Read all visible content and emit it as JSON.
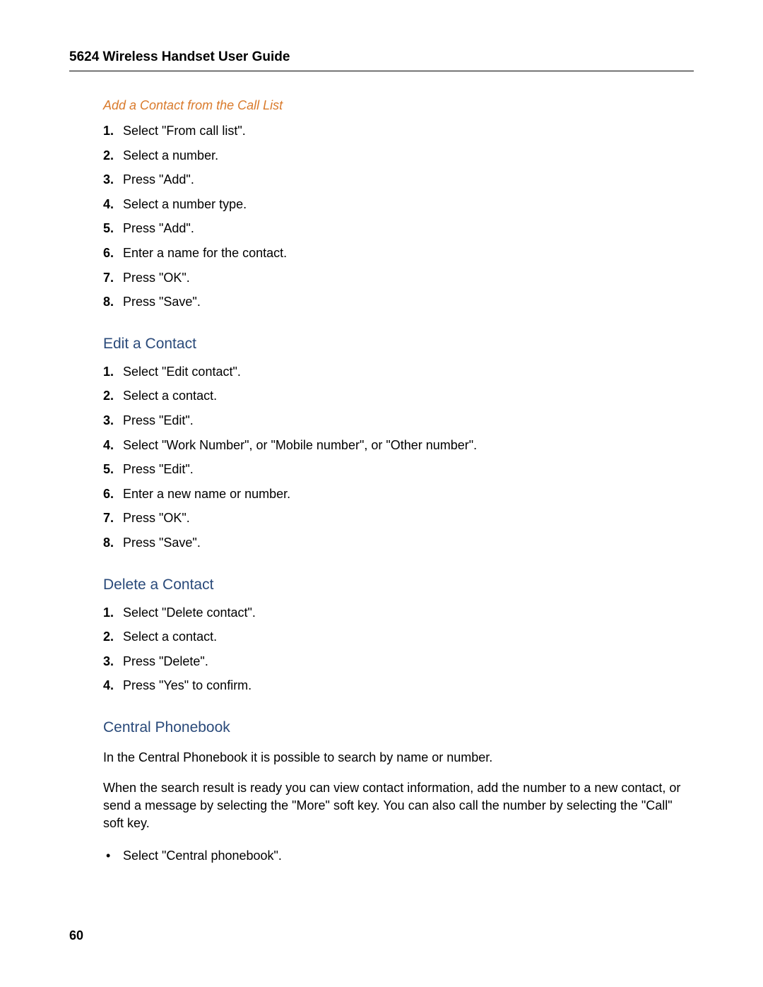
{
  "header": {
    "title": "5624 Wireless Handset User Guide"
  },
  "sections": {
    "addContact": {
      "title": "Add a Contact from the Call List",
      "steps": [
        "Select \"From call list\".",
        "Select a number.",
        "Press \"Add\".",
        "Select a number type.",
        "Press \"Add\".",
        "Enter a name for the contact.",
        "Press \"OK\".",
        "Press \"Save\"."
      ]
    },
    "editContact": {
      "title": "Edit a Contact",
      "steps": [
        "Select \"Edit contact\".",
        "Select a contact.",
        "Press \"Edit\".",
        "Select \"Work Number\", or \"Mobile number\", or \"Other number\".",
        "Press \"Edit\".",
        "Enter a new name or number.",
        "Press \"OK\".",
        "Press \"Save\"."
      ]
    },
    "deleteContact": {
      "title": "Delete a Contact",
      "steps": [
        "Select \"Delete contact\".",
        "Select a contact.",
        "Press \"Delete\".",
        "Press \"Yes\" to confirm."
      ]
    },
    "centralPhonebook": {
      "title": "Central Phonebook",
      "para1": "In the Central Phonebook it is possible to search by name or number.",
      "para2": "When the search result is ready you can view contact information, add the number to a new contact, or send a message by selecting the \"More\" soft key. You can also call the number by selecting the \"Call\" soft key.",
      "bullets": [
        "Select \"Central phonebook\"."
      ]
    }
  },
  "pageNumber": "60"
}
